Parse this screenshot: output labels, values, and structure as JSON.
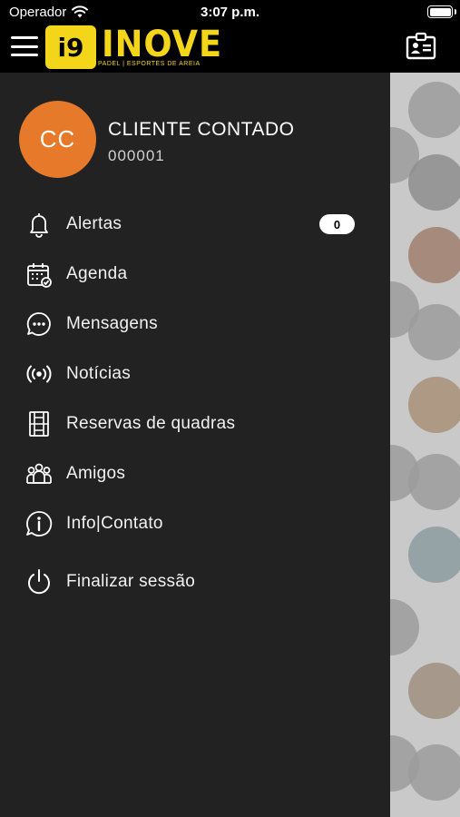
{
  "status_bar": {
    "carrier": "Operador",
    "time": "3:07 p.m."
  },
  "header": {
    "logo_mark": "i9",
    "logo_text": "INOVE",
    "logo_subtitle": "PADEL | ESPORTES DE AREIA",
    "brand_color": "#f3d51a",
    "card_icon": "id-card-icon"
  },
  "user": {
    "initials": "CC",
    "name": "CLIENTE CONTADO",
    "id": "000001",
    "avatar_color": "#e67a2a"
  },
  "menu": {
    "items": [
      {
        "label": "Alertas",
        "icon": "bell-icon",
        "badge": "0"
      },
      {
        "label": "Agenda",
        "icon": "calendar-check-icon"
      },
      {
        "label": "Mensagens",
        "icon": "chat-bubble-icon"
      },
      {
        "label": "Notícias",
        "icon": "broadcast-icon"
      },
      {
        "label": "Reservas de quadras",
        "icon": "court-icon"
      },
      {
        "label": "Amigos",
        "icon": "group-icon"
      },
      {
        "label": "Info|Contato",
        "icon": "info-chat-icon"
      },
      {
        "label": "Finalizar sessão",
        "icon": "power-icon"
      }
    ]
  }
}
